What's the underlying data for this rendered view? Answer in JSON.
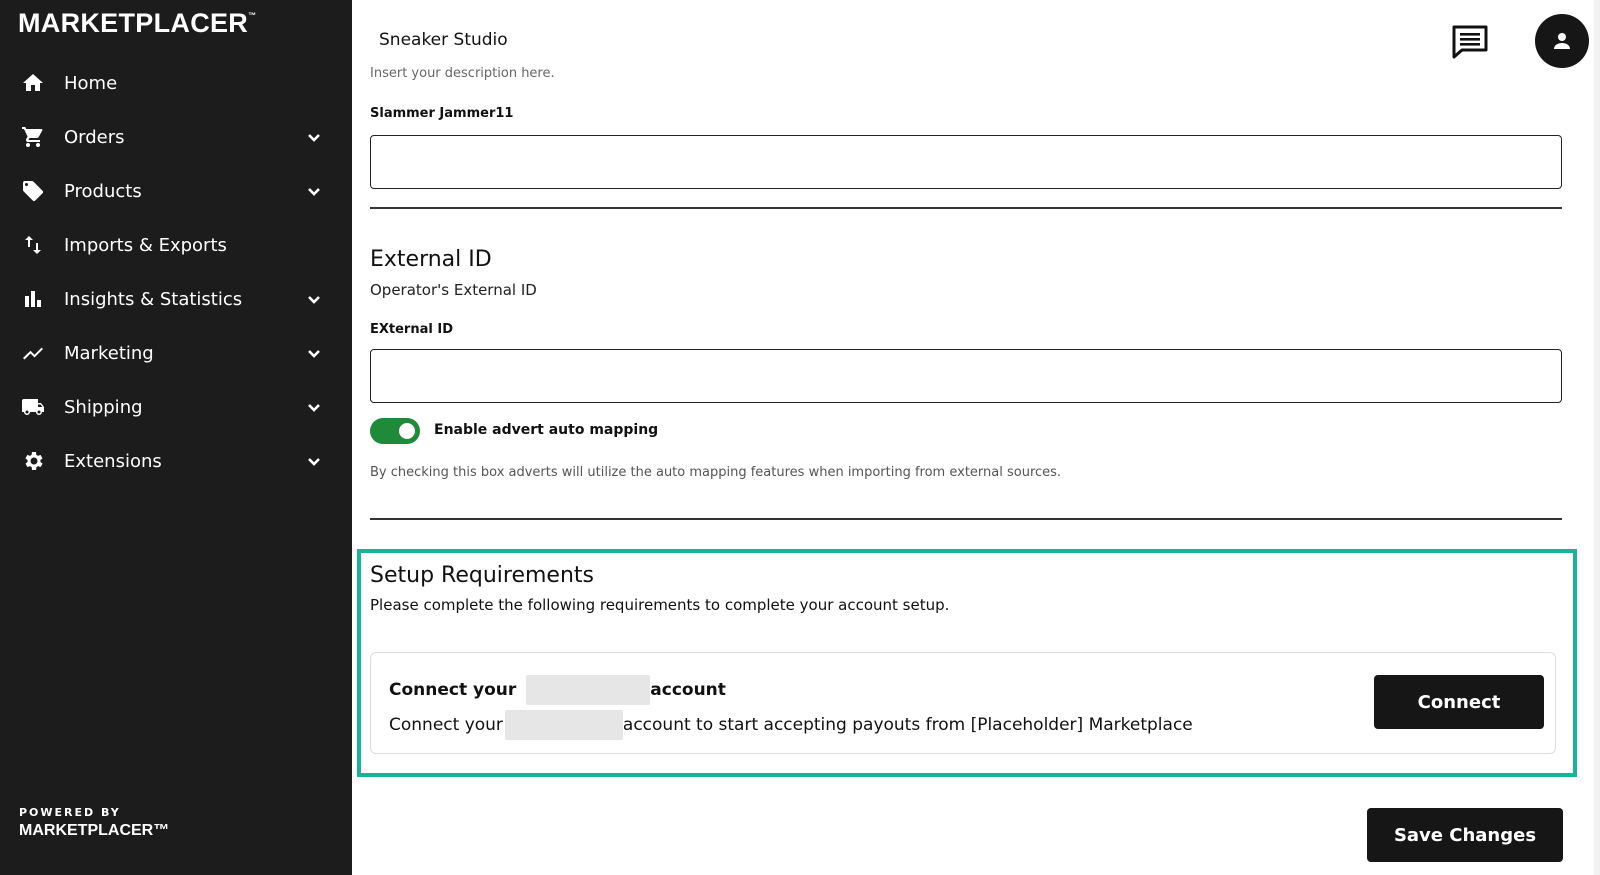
{
  "brand": {
    "logo_text": "MARKETPLACER",
    "logo_tm": "™",
    "powered_by": "POWERED BY",
    "powered_logo": "MARKETPLACER™"
  },
  "sidebar": {
    "items": [
      {
        "label": "Home",
        "icon": "home-icon",
        "has_chevron": false
      },
      {
        "label": "Orders",
        "icon": "cart-icon",
        "has_chevron": true
      },
      {
        "label": "Products",
        "icon": "tag-icon",
        "has_chevron": true
      },
      {
        "label": "Imports & Exports",
        "icon": "import-export-icon",
        "has_chevron": false
      },
      {
        "label": "Insights & Statistics",
        "icon": "bar-chart-icon",
        "has_chevron": true
      },
      {
        "label": "Marketing",
        "icon": "trending-icon",
        "has_chevron": true
      },
      {
        "label": "Shipping",
        "icon": "truck-icon",
        "has_chevron": true
      },
      {
        "label": "Extensions",
        "icon": "gear-icon",
        "has_chevron": true
      }
    ]
  },
  "header": {
    "store_name": "Sneaker Studio"
  },
  "form": {
    "description_hint": "Insert your description here.",
    "slammer_label": "Slammer Jammer11",
    "slammer_value": "",
    "external_title": "External ID",
    "external_sub": "Operator's External ID",
    "external_label": "EXternal ID",
    "external_value": "",
    "toggle_label": "Enable advert auto mapping",
    "toggle_on": true,
    "toggle_help": "By checking this box adverts will utilize the auto mapping features when importing from external sources."
  },
  "setup": {
    "title": "Setup Requirements",
    "subtitle": "Please complete the following requirements to complete your account setup.",
    "card_title_prefix": "Connect your",
    "card_title_suffix": "account",
    "card_desc_prefix": "Connect your",
    "card_desc_suffix": "account to start accepting payouts from [Placeholder] Marketplace",
    "connect_label": "Connect"
  },
  "actions": {
    "save_label": "Save Changes"
  },
  "colors": {
    "sidebar_bg": "#1c1c1c",
    "accent_highlight": "#17b39a",
    "toggle_on": "#1f8a3a",
    "button_bg": "#161616"
  }
}
